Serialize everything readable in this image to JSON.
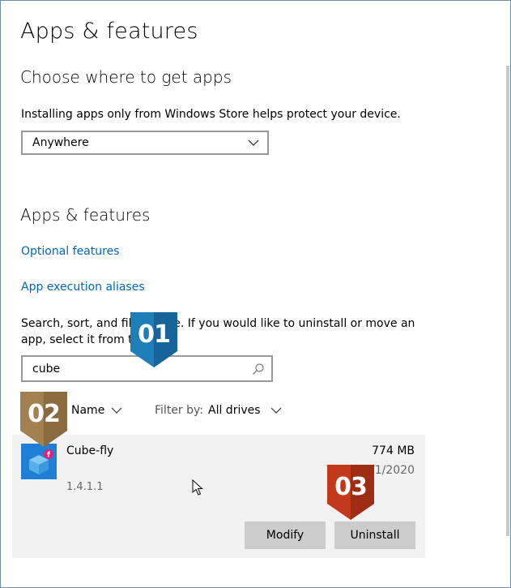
{
  "page": {
    "title": "Apps & features"
  },
  "choose_section": {
    "title": "Choose where to get apps",
    "description": "Installing apps only from Windows Store helps protect your device.",
    "dropdown_value": "Anywhere"
  },
  "apps_section": {
    "title": "Apps & features",
    "optional_features_link": "Optional features",
    "aliases_link": "App execution aliases",
    "desc_line1_a": "Search, sort, and filt",
    "desc_line1_b": "ve. If you would like to uninstall or move an",
    "desc_line2_a": "app, select it from th",
    "search_value": "cube",
    "sort_label": "Name",
    "filter_prefix": "Filter by:",
    "filter_value": "All drives"
  },
  "app": {
    "name": "Cube-fly",
    "version": "1.4.1.1",
    "size": "774 MB",
    "date": "/1/2020",
    "modify_label": "Modify",
    "uninstall_label": "Uninstall"
  },
  "badges": {
    "b1": "01",
    "b2": "02",
    "b3": "03"
  },
  "colors": {
    "link": "#0067b8",
    "badge_blue": "#1e7fb8",
    "badge_gold": "#a2804f",
    "badge_red": "#c23a1c",
    "app_icon": "#1f7fd6"
  }
}
